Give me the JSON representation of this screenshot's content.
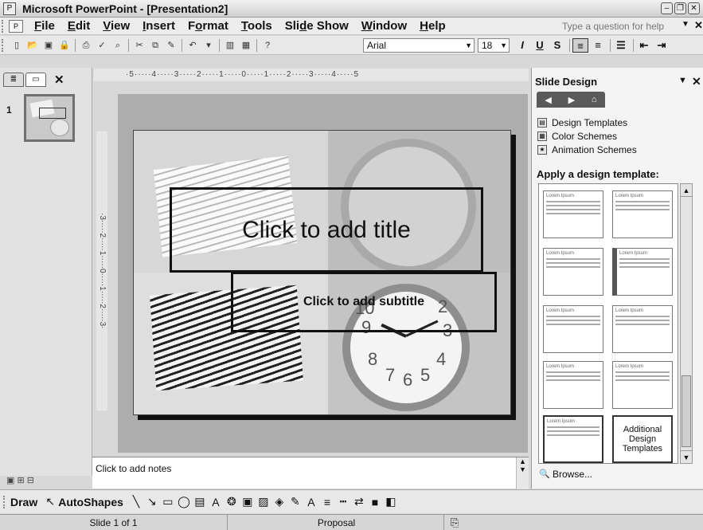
{
  "window": {
    "title": "Microsoft PowerPoint - [Presentation2]",
    "app_icon": "powerpoint-icon"
  },
  "menu": {
    "items": [
      {
        "label": "File",
        "underline": "F"
      },
      {
        "label": "Edit",
        "underline": "E"
      },
      {
        "label": "View",
        "underline": "V"
      },
      {
        "label": "Insert",
        "underline": "I"
      },
      {
        "label": "Format",
        "underline": "o"
      },
      {
        "label": "Tools",
        "underline": "T"
      },
      {
        "label": "Slide Show",
        "underline": "d"
      },
      {
        "label": "Window",
        "underline": "W"
      },
      {
        "label": "Help",
        "underline": "H"
      }
    ],
    "help_placeholder": "Type a question for help"
  },
  "toolbar": {
    "font_name": "Arial",
    "font_size": "18",
    "icons": [
      "new-icon",
      "open-icon",
      "save-icon",
      "permission-icon",
      "print-icon",
      "spelling-icon",
      "research-icon",
      "cut-icon",
      "copy-icon",
      "paste-icon",
      "format-painter-icon",
      "undo-icon",
      "chart-icon",
      "table-icon",
      "help-icon"
    ],
    "format_buttons": [
      "I",
      "U",
      "S"
    ]
  },
  "outline": {
    "slide_number": "1"
  },
  "slide": {
    "title_placeholder": "Click to add title",
    "subtitle_placeholder": "Click to add subtitle"
  },
  "notes": {
    "placeholder": "Click to add notes"
  },
  "taskpane": {
    "title": "Slide Design",
    "links": [
      {
        "label": "Design Templates",
        "icon": "design-templates-icon"
      },
      {
        "label": "Color Schemes",
        "icon": "color-schemes-icon"
      },
      {
        "label": "Animation Schemes",
        "icon": "animation-schemes-icon"
      }
    ],
    "apply_label": "Apply a design template:",
    "template_sample": "Lorem Ipsum",
    "additional_label": "Additional Design Templates",
    "browse_label": "Browse..."
  },
  "drawbar": {
    "draw_label": "Draw",
    "autoshapes_label": "AutoShapes"
  },
  "status": {
    "slide_info": "Slide 1 of 1",
    "design": "Proposal"
  }
}
